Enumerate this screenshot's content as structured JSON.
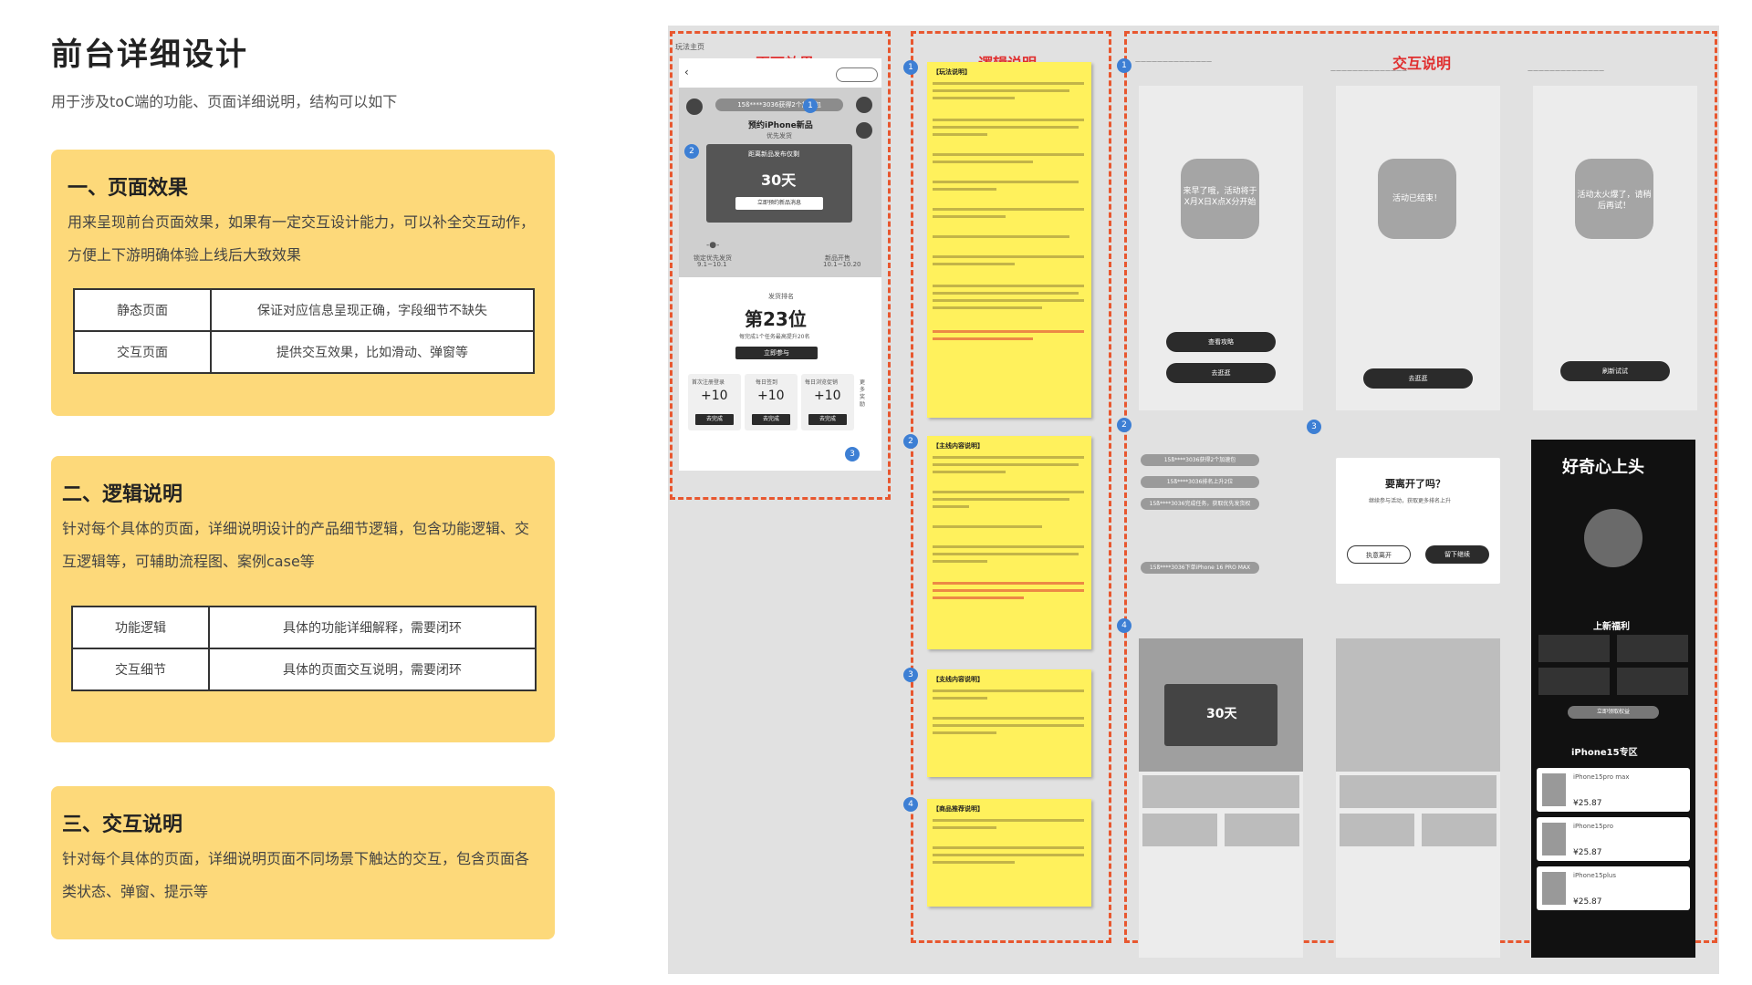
{
  "page": {
    "title": "前台详细设计",
    "subtitle": "用于涉及toC端的功能、页面详细说明，结构可以如下"
  },
  "sections": [
    {
      "title": "一、页面效果",
      "desc": "用来呈现前台页面效果，如果有一定交互设计能力，可以补全交互动作，方便上下游明确体验上线后大致效果",
      "rows": [
        [
          "静态页面",
          "保证对应信息呈现正确，字段细节不缺失"
        ],
        [
          "交互页面",
          "提供交互效果，比如滑动、弹窗等"
        ]
      ]
    },
    {
      "title": "二、逻辑说明",
      "desc": "针对每个具体的页面，详细说明设计的产品细节逻辑，包含功能逻辑、交互逻辑等，可辅助流程图、案例case等",
      "rows": [
        [
          "功能逻辑",
          "具体的功能详细解释，需要闭环"
        ],
        [
          "交互细节",
          "具体的页面交互说明，需要闭环"
        ]
      ]
    },
    {
      "title": "三、交互说明",
      "desc": "针对每个具体的页面，详细说明页面不同场景下触达的交互，包含页面各类状态、弹窗、提示等",
      "rows": []
    }
  ],
  "board": {
    "caption": "玩法主页",
    "frame_labels": [
      "页面效果",
      "逻辑说明",
      "交互说明"
    ],
    "phone": {
      "banner": "15ß****3036获得2个加速包",
      "headline": "预约iPhone新品",
      "headline_sub": "优先发货",
      "countdown_title": "距离新品发布仅剩",
      "countdown_value": "30天",
      "countdown_button": "立即预约新品消息",
      "timeline_left": "锁定优先发货",
      "timeline_left_date": "9.1~10.1",
      "timeline_right": "新品开售",
      "timeline_right_date": "10.1~10.20",
      "rank_label": "发货排名",
      "rank_value": "第23位",
      "rank_hint": "每完成1个任务最高提升20名",
      "rank_button": "立即参与",
      "tasks": [
        {
          "label": "首次注册登录",
          "value": "+10",
          "button": "去完成"
        },
        {
          "label": "每日签到",
          "value": "+10",
          "button": "去完成"
        },
        {
          "label": "每日浏览促销",
          "value": "+10",
          "button": "去完成"
        }
      ],
      "more": "更多奖励"
    },
    "sticky_titles": [
      "【玩法说明】",
      "【主线内容说明】",
      "【支线内容说明】",
      "【商品推荐说明】"
    ],
    "states": {
      "toast_1": "来早了哦，活动将于X月X日X点X分开始",
      "toast_2": "活动已结束！",
      "toast_3": "活动太火爆了，请稍后再试！",
      "btn_strategy": "查看攻略",
      "btn_go": "去逛逛",
      "btn_refresh": "刷新试试",
      "modal_title": "要离开了吗？",
      "modal_hint": "继续参与活动，获取更多排名上升",
      "modal_leave": "执意离开",
      "modal_stay": "留下继续",
      "pill_1": "15ß****3036获得2个加速包",
      "pill_2": "15ß****3036排名上升2位",
      "pill_3": "15ß****3036完成任务，获取优先发货权",
      "pill_4": "15ß****3036下单iPhone 16 PRO MAX",
      "mini_countdown": "30天"
    },
    "promo": {
      "headline": "好奇心上头",
      "benefit_title": "上新福利",
      "coupon_button": "立即领取权益",
      "zone_title": "iPhone15专区",
      "products": [
        {
          "name": "iPhone15pro max",
          "price": "¥25.87"
        },
        {
          "name": "iPhone15pro",
          "price": "¥25.87"
        },
        {
          "name": "iPhone15plus",
          "price": "¥25.87"
        }
      ]
    }
  }
}
